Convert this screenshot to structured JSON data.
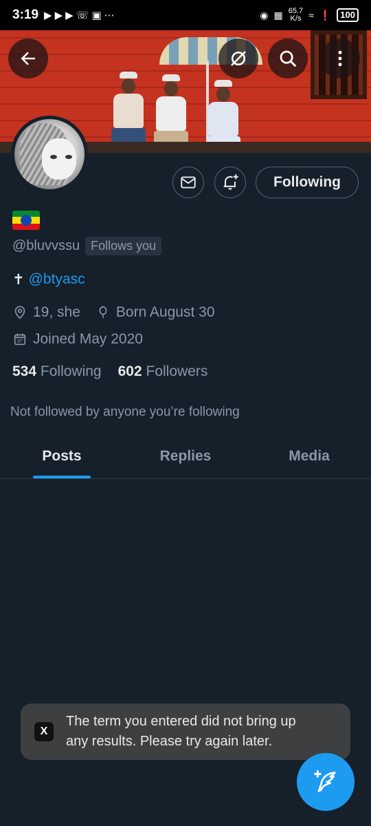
{
  "status_bar": {
    "time": "3:19",
    "speed": "65.7",
    "speed_unit": "K/s",
    "battery": "100"
  },
  "profile": {
    "flag": "Ethiopia flag",
    "handle": "@bluvvssu",
    "follows_you": "Follows you",
    "bio_prefix": "✝",
    "bio_link": "@btyasc",
    "location": "19, she",
    "birthday": "Born August 30",
    "joined": "Joined May 2020",
    "following_count": "534",
    "following_label": "Following",
    "followers_count": "602",
    "followers_label": "Followers",
    "not_followed": "Not followed by anyone you’re following"
  },
  "actions": {
    "follow_button": "Following",
    "message_icon": "mail-icon",
    "notify_icon": "bell-plus-icon"
  },
  "tabs": [
    {
      "label": "Posts",
      "active": true
    },
    {
      "label": "Replies",
      "active": false
    },
    {
      "label": "Media",
      "active": false
    }
  ],
  "toast": {
    "badge": "X",
    "message_line1": "The term you entered did not bring up",
    "message_line2": "any results. Please try again later."
  },
  "colors": {
    "background": "#15202b",
    "accent": "#1d9bf0",
    "muted": "#8b98a5"
  }
}
